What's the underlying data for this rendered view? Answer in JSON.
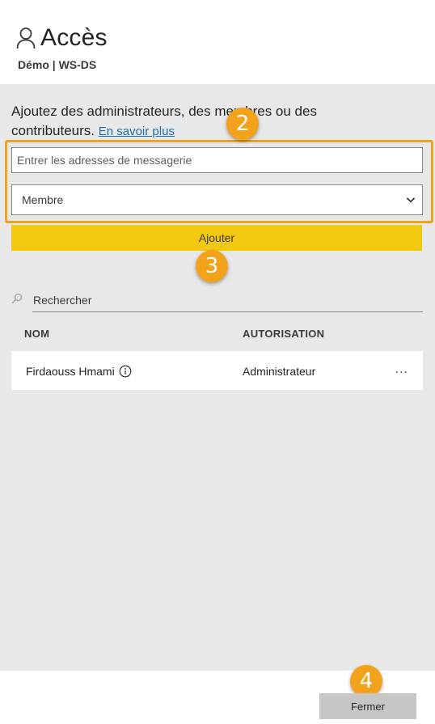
{
  "header": {
    "title": "Accès",
    "subtitle": "Démo | WS-DS"
  },
  "description": {
    "text": "Ajoutez des administrateurs, des membres ou des contributeurs.",
    "link": "En savoir plus"
  },
  "form": {
    "email_placeholder": "Entrer les adresses de messagerie",
    "role_selected": "Membre",
    "add_label": "Ajouter"
  },
  "search": {
    "placeholder": "Rechercher"
  },
  "table": {
    "columns": [
      "NOM",
      "AUTORISATION"
    ],
    "rows": [
      {
        "name": "Firdaouss Hmami",
        "role": "Administrateur",
        "more": "..."
      }
    ]
  },
  "footer": {
    "close_label": "Fermer"
  },
  "badges": [
    "2",
    "3",
    "4"
  ],
  "colors": {
    "accent_yellow": "#f2c811",
    "highlight_orange": "#f2a31b",
    "link_blue": "#1f6fb5",
    "panel_gray": "#e8e8e8"
  },
  "icons": [
    "person-icon",
    "chevron-down-icon",
    "search-icon",
    "info-icon"
  ]
}
